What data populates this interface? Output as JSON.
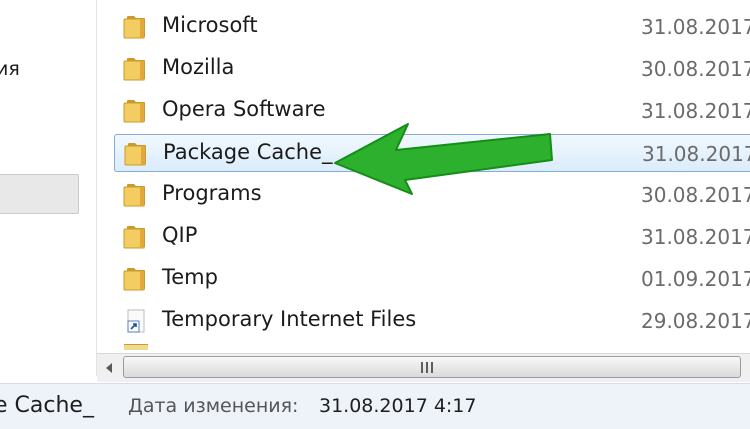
{
  "navigation": {
    "partial_label": "ия"
  },
  "files": [
    {
      "name": "Microsoft",
      "date": "31.08.2017",
      "icon": "folder-icon"
    },
    {
      "name": "Mozilla",
      "date": "30.08.2017",
      "icon": "folder-icon"
    },
    {
      "name": "Opera Software",
      "date": "31.08.2017",
      "icon": "folder-icon"
    },
    {
      "name": "Package Cache_",
      "date": "31.08.2017",
      "icon": "folder-icon",
      "selected": true
    },
    {
      "name": "Programs",
      "date": "30.08.2017",
      "icon": "folder-icon"
    },
    {
      "name": "QIP",
      "date": "31.08.2017",
      "icon": "folder-icon"
    },
    {
      "name": "Temp",
      "date": "01.09.2017",
      "icon": "folder-icon"
    },
    {
      "name": "Temporary Internet Files",
      "date": "29.08.2017",
      "icon": "shortcut-icon"
    }
  ],
  "status_bar": {
    "selected_name": "e Cache_",
    "modified_label": "Дата изменения:",
    "modified_value": "31.08.2017 4:17"
  },
  "colors": {
    "selection": "#cce4f7",
    "selection_border": "#84acdd",
    "folder": "#e8b84a",
    "arrow": "#2db02d"
  }
}
